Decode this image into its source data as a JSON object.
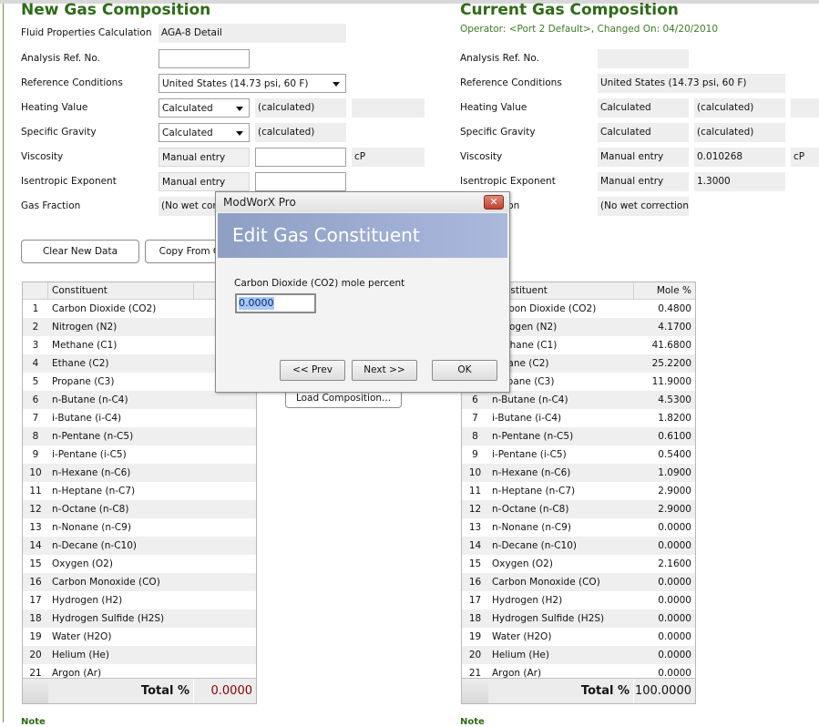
{
  "new": {
    "title": "New Gas Composition",
    "labels": [
      "Fluid Properties Calculation",
      "Analysis Ref. No.",
      "Reference Conditions",
      "Heating Value",
      "Specific Gravity",
      "Viscosity",
      "Isentropic Exponent",
      "Gas Fraction"
    ],
    "fluid_calc": "AGA-8 Detail",
    "analysis_ref": "",
    "ref_conditions": "United States (14.73 psi, 60 F)",
    "heating_mode": "Calculated",
    "heating_value": "(calculated)",
    "sg_mode": "Calculated",
    "sg_value": "(calculated)",
    "visc_mode": "Manual entry",
    "visc_value": "",
    "visc_unit": "cP",
    "isen_mode": "Manual entry",
    "isen_value": "",
    "gas_fraction": "(No wet correction)",
    "buttons": {
      "clear": "Clear New Data",
      "copy": "Copy From Current",
      "load": "Load Composition..."
    },
    "total_label": "Total %",
    "total": "0.0000",
    "total_color": "#8b0000"
  },
  "current": {
    "title": "Current Gas Composition",
    "subtitle": "Operator: <Port 2 Default>, Changed On: 04/20/2010",
    "labels": [
      "Analysis Ref. No.",
      "Reference Conditions",
      "Heating Value",
      "Specific Gravity",
      "Viscosity",
      "Isentropic Exponent",
      "Gas Fraction"
    ],
    "analysis_ref": "",
    "ref_conditions": "United States (14.73 psi, 60 F)",
    "heating_mode": "Calculated",
    "heating_value": "(calculated)",
    "sg_mode": "Calculated",
    "sg_value": "(calculated)",
    "visc_mode": "Manual entry",
    "visc_value": "0.010268",
    "visc_unit": "cP",
    "isen_mode": "Manual entry",
    "isen_value": "1.3000",
    "gas_fraction": "(No wet correction)",
    "total_label": "Total %",
    "total": "100.0000"
  },
  "table": {
    "headers": [
      "Constituent",
      "Mole %"
    ],
    "constituents": [
      "Carbon Dioxide (CO2)",
      "Nitrogen (N2)",
      "Methane (C1)",
      "Ethane (C2)",
      "Propane (C3)",
      "n-Butane (n-C4)",
      "i-Butane (i-C4)",
      "n-Pentane (n-C5)",
      "i-Pentane (i-C5)",
      "n-Hexane (n-C6)",
      "n-Heptane (n-C7)",
      "n-Octane (n-C8)",
      "n-Nonane (n-C9)",
      "n-Decane (n-C10)",
      "Oxygen (O2)",
      "Carbon Monoxide (CO)",
      "Hydrogen (H2)",
      "Hydrogen Sulfide (H2S)",
      "Water (H2O)",
      "Helium (He)",
      "Argon (Ar)"
    ],
    "current_values": [
      "0.4800",
      "4.1700",
      "41.6800",
      "25.2200",
      "11.9000",
      "4.5300",
      "1.8200",
      "0.6100",
      "0.5400",
      "1.0900",
      "2.9000",
      "2.9000",
      "0.0000",
      "0.0000",
      "2.1600",
      "0.0000",
      "0.0000",
      "0.0000",
      "0.0000",
      "0.0000",
      "0.0000"
    ]
  },
  "dialog": {
    "window_title": "ModWorX Pro",
    "heading": "Edit Gas Constituent",
    "field_label": "Carbon Dioxide (CO2) mole percent",
    "field_value": "0.0000",
    "prev": "<< Prev",
    "next": "Next >>",
    "ok": "OK",
    "close": "✕"
  },
  "note_label": "Note",
  "colors": {
    "heading": "#2e6b18",
    "banner": "#9aaad0",
    "accent_red": "#8b0000"
  }
}
